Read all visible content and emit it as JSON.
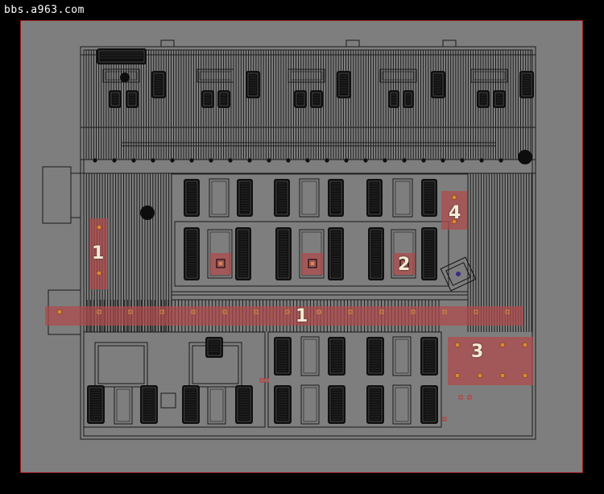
{
  "watermark": "bbs.a963.com",
  "zones": [
    {
      "id": "zone-1-left",
      "label": "1"
    },
    {
      "id": "zone-1-aisle",
      "label": "1"
    },
    {
      "id": "zone-2",
      "label": "2"
    },
    {
      "id": "zone-3",
      "label": "3"
    },
    {
      "id": "zone-4",
      "label": "4"
    }
  ],
  "colors": {
    "background": "#000000",
    "viewport": "#7e7e7e",
    "frame": "#9a1c1c",
    "linework": "#1a1a1a",
    "zone_fill": "#b04a4a",
    "light_fixture": "#d98a3a",
    "label": "#f4ead4"
  }
}
